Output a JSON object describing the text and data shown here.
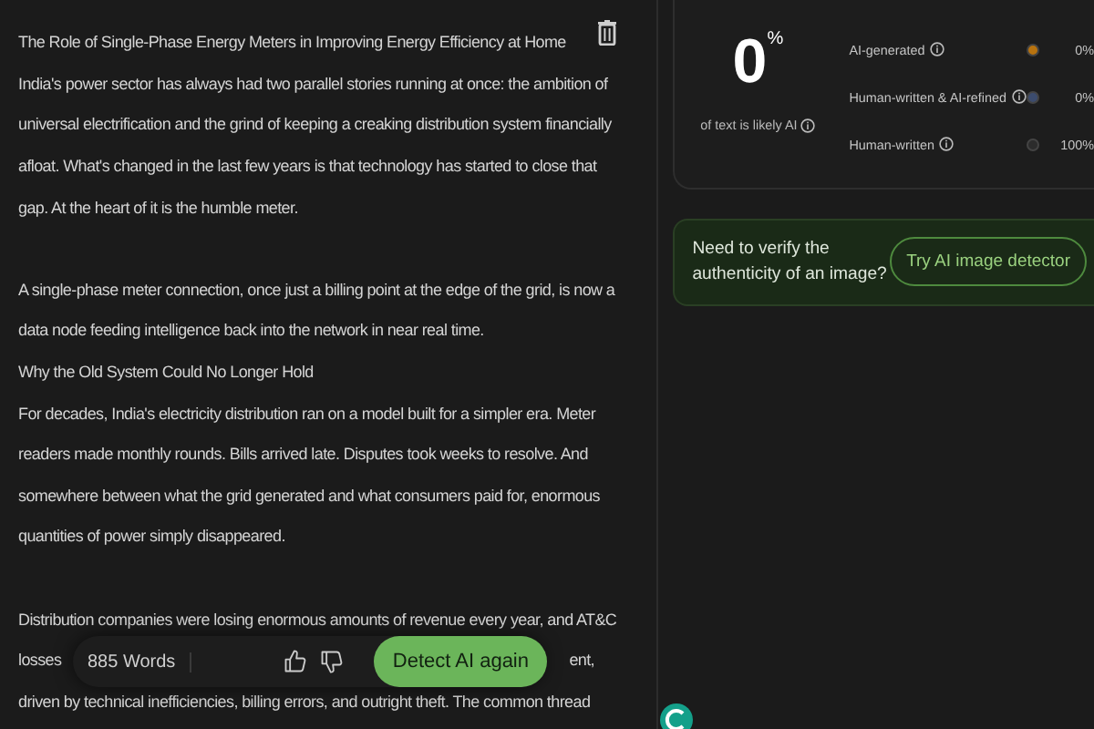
{
  "editor": {
    "lines": [
      {
        "kind": "line",
        "text": "The Role of Single-Phase Energy Meters in Improving Energy Efficiency at Home"
      },
      {
        "kind": "line",
        "text": "India's power sector has always had two parallel stories running at once: the ambition of"
      },
      {
        "kind": "line",
        "text": "universal electrification and the grind of keeping a creaking distribution system financially"
      },
      {
        "kind": "line",
        "text": "afloat. What's changed in the last few years is that technology has started to close that"
      },
      {
        "kind": "line",
        "text": "gap. At the heart of it is the humble meter."
      },
      {
        "kind": "blank"
      },
      {
        "kind": "line",
        "text": "A single-phase meter connection, once just a billing point at the edge of the grid, is now a"
      },
      {
        "kind": "line",
        "text": "data node feeding intelligence back into the network in near real time."
      },
      {
        "kind": "line",
        "text": "Why the Old System Could No Longer Hold"
      },
      {
        "kind": "line",
        "text": "For decades, India's electricity distribution ran on a model built for a simpler era. Meter"
      },
      {
        "kind": "line",
        "text": "readers made monthly rounds. Bills arrived late. Disputes took weeks to resolve. And"
      },
      {
        "kind": "line",
        "text": "somewhere between what the grid generated and what consumers paid for, enormous"
      },
      {
        "kind": "line",
        "text": "quantities of power simply disappeared."
      },
      {
        "kind": "blank"
      },
      {
        "kind": "line",
        "text": "Distribution companies were losing enormous amounts of revenue every year, and AT&C"
      },
      {
        "kind": "split",
        "left": "losses",
        "right": "ent,"
      },
      {
        "kind": "line",
        "text": "driven by technical inefficiencies, billing errors, and outright theft. The common thread"
      }
    ]
  },
  "action_bar": {
    "word_count": "885 Words",
    "button": "Detect AI again"
  },
  "result": {
    "score": "0",
    "unit": "%",
    "caption": "of text is likely AI",
    "rows": [
      {
        "label": "AI-generated",
        "color": "#b8730f",
        "value": "0%"
      },
      {
        "label": "Human-written & AI-refined",
        "color": "#3c4c6e",
        "value": "0%"
      },
      {
        "label": "Human-written",
        "color": "#2c2c2c",
        "value": "100%"
      }
    ]
  },
  "promo": {
    "text": "Need to verify the authenticity of an image?",
    "button": "Try AI image detector"
  }
}
